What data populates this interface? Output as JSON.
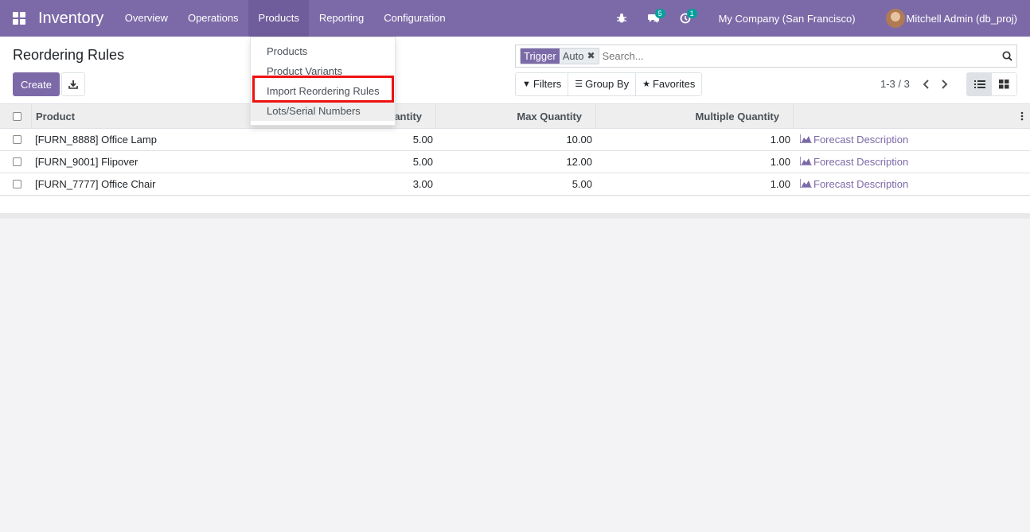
{
  "navbar": {
    "app_title": "Inventory",
    "menu": [
      {
        "label": "Overview"
      },
      {
        "label": "Operations"
      },
      {
        "label": "Products"
      },
      {
        "label": "Reporting"
      },
      {
        "label": "Configuration"
      }
    ],
    "messages_count": "5",
    "activities_count": "1",
    "company": "My Company (San Francisco)",
    "user": "Mitchell Admin (db_proj)"
  },
  "dropdown": {
    "items": [
      {
        "label": "Products"
      },
      {
        "label": "Product Variants"
      },
      {
        "label": "Import Reordering Rules"
      },
      {
        "label": "Lots/Serial Numbers"
      }
    ]
  },
  "control_panel": {
    "title": "Reordering Rules",
    "create_label": "Create",
    "search": {
      "facet_label": "Trigger",
      "facet_value": "Auto",
      "placeholder": "Search..."
    },
    "filters_label": "Filters",
    "group_by_label": "Group By",
    "favorites_label": "Favorites",
    "pager": "1-3 / 3"
  },
  "table": {
    "headers": {
      "product": "Product",
      "min_qty": "antity",
      "max_qty": "Max Quantity",
      "multiple_qty": "Multiple Quantity"
    },
    "rows": [
      {
        "product": "[FURN_8888] Office Lamp",
        "min": "5.00",
        "max": "10.00",
        "multiple": "1.00",
        "action": "Forecast Description"
      },
      {
        "product": "[FURN_9001] Flipover",
        "min": "5.00",
        "max": "12.00",
        "multiple": "1.00",
        "action": "Forecast Description"
      },
      {
        "product": "[FURN_7777] Office Chair",
        "min": "3.00",
        "max": "5.00",
        "multiple": "1.00",
        "action": "Forecast Description"
      }
    ]
  },
  "colors": {
    "brand": "#7c6aa8",
    "badge": "#00a09d",
    "highlight": "#ee1111"
  }
}
